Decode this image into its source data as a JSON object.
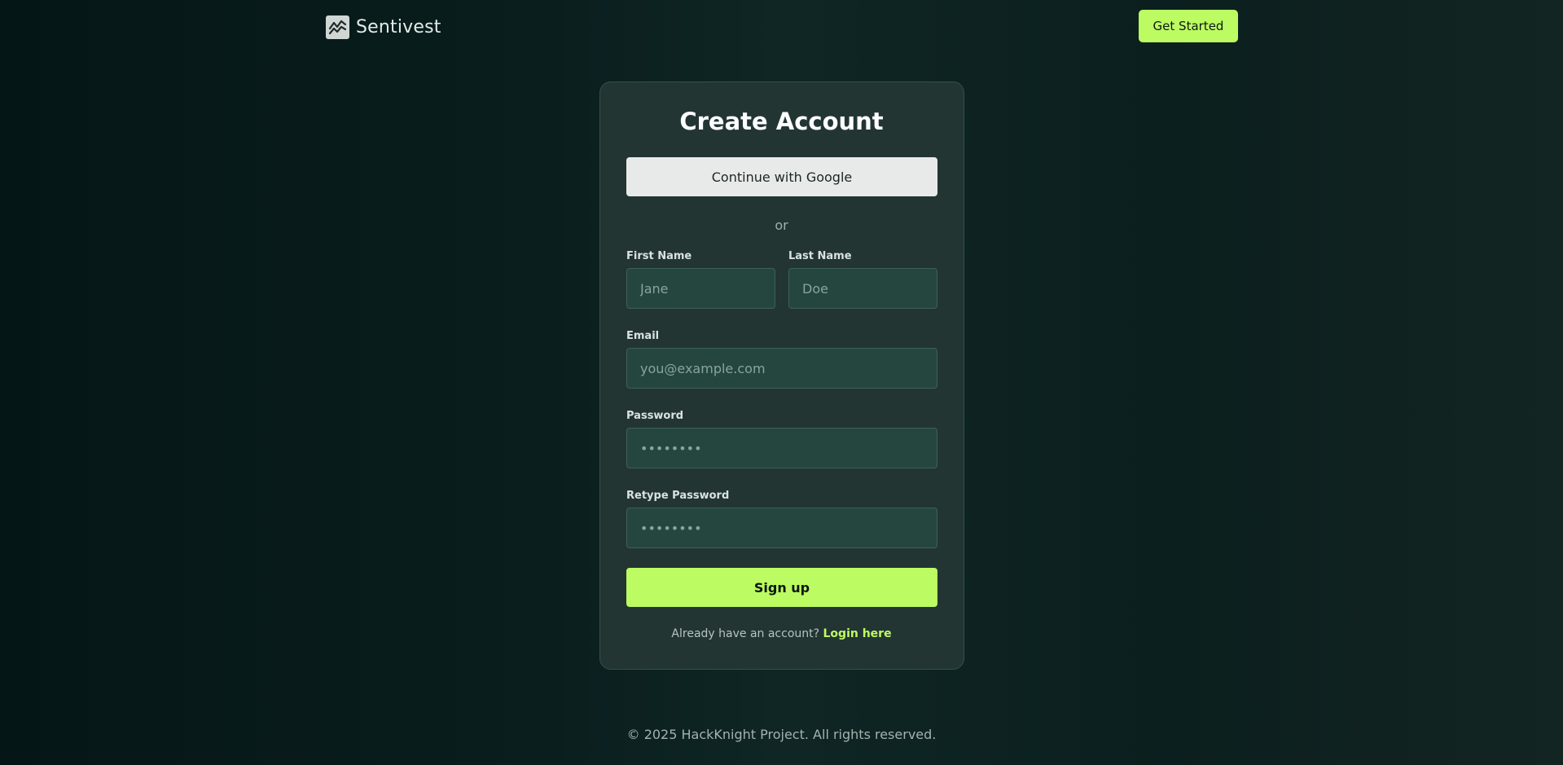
{
  "header": {
    "brand_icon": "chart-line-icon",
    "brand_name": "Sentivest",
    "cta_label": "Get Started"
  },
  "card": {
    "title": "Create Account",
    "google_label": "Continue with Google",
    "divider": "or",
    "first_name": {
      "label": "First Name",
      "placeholder": "Jane",
      "value": ""
    },
    "last_name": {
      "label": "Last Name",
      "placeholder": "Doe",
      "value": ""
    },
    "email": {
      "label": "Email",
      "placeholder": "you@example.com",
      "value": ""
    },
    "password": {
      "label": "Password",
      "placeholder": "••••••••",
      "value": ""
    },
    "retype_password": {
      "label": "Retype Password",
      "placeholder": "••••••••",
      "value": ""
    },
    "submit_label": "Sign up",
    "login_prompt": "Already have an account?",
    "login_link": "Login here"
  },
  "footer": {
    "text": "© 2025 HackKnight Project. All rights reserved."
  },
  "colors": {
    "accent": "#bdfb62",
    "card_bg": "#223533",
    "input_bg": "#24463f"
  }
}
